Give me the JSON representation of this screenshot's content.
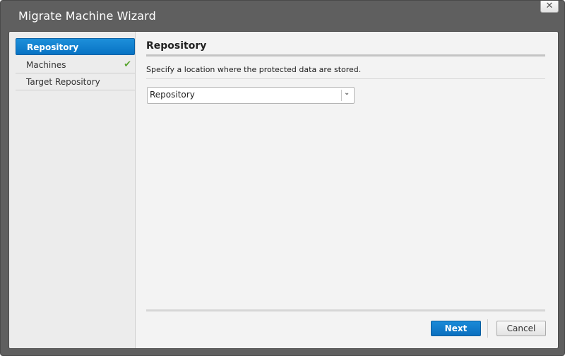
{
  "window": {
    "title": "Migrate Machine Wizard",
    "close_glyph": "✕"
  },
  "sidebar": {
    "items": [
      {
        "label": "Repository",
        "active": true
      },
      {
        "label": "Machines",
        "completed": true,
        "check_glyph": "✔"
      },
      {
        "label": "Target Repository"
      }
    ]
  },
  "main": {
    "section_title": "Repository",
    "description": "Specify a location where the protected data are stored.",
    "repository_select": {
      "value": "Repository",
      "chevron_glyph": "⌄"
    }
  },
  "footer": {
    "next_label": "Next",
    "cancel_label": "Cancel"
  },
  "colors": {
    "accent": "#0a78c8",
    "check": "#5aa532",
    "frame": "#5f5f5f"
  }
}
